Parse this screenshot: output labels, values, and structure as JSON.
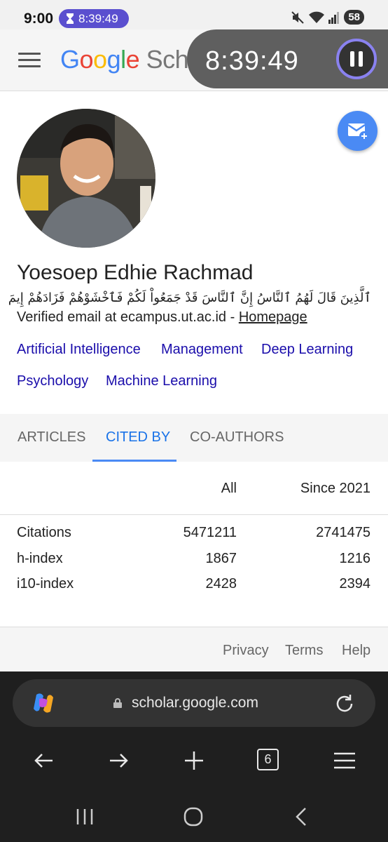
{
  "status_bar": {
    "time": "9:00",
    "timer_pill": "8:39:49",
    "battery": "58"
  },
  "header": {
    "logo_google": "Google",
    "logo_scholar": "Scho"
  },
  "timer_overlay": {
    "time": "8:39:49"
  },
  "profile": {
    "name": "Yoesoep Edhie Rachmad",
    "bio": "ٱلَّذِينَ قَالَ لَهُمُ ٱلنَّاسُ إِنَّ ٱلنَّاسَ قَدْ جَمَعُواْ لَكُمْ فَٱخْشَوْهُمْ فَزَادَهُمْ إِيمَ",
    "email_text": "Verified email at ecampus.ut.ac.id - ",
    "homepage_label": "Homepage",
    "interests": [
      "Artificial Intelligence",
      "Management",
      "Deep Learning",
      "Psychology",
      "Machine Learning"
    ]
  },
  "tabs": [
    {
      "label": "ARTICLES",
      "active": false
    },
    {
      "label": "CITED BY",
      "active": true
    },
    {
      "label": "CO-AUTHORS",
      "active": false
    }
  ],
  "citations_table": {
    "headers": [
      "All",
      "Since 2021"
    ],
    "rows": [
      {
        "label": "Citations",
        "all": "5471211",
        "since": "2741475"
      },
      {
        "label": "h-index",
        "all": "1867",
        "since": "1216"
      },
      {
        "label": "i10-index",
        "all": "2428",
        "since": "2394"
      }
    ]
  },
  "footer": {
    "links": [
      "Privacy",
      "Terms",
      "Help"
    ]
  },
  "browser": {
    "url": "scholar.google.com",
    "tab_count": "6"
  },
  "colors": {
    "link": "#1a0dab",
    "accent": "#1a73e8",
    "timer_purple": "#5a4fcf"
  }
}
